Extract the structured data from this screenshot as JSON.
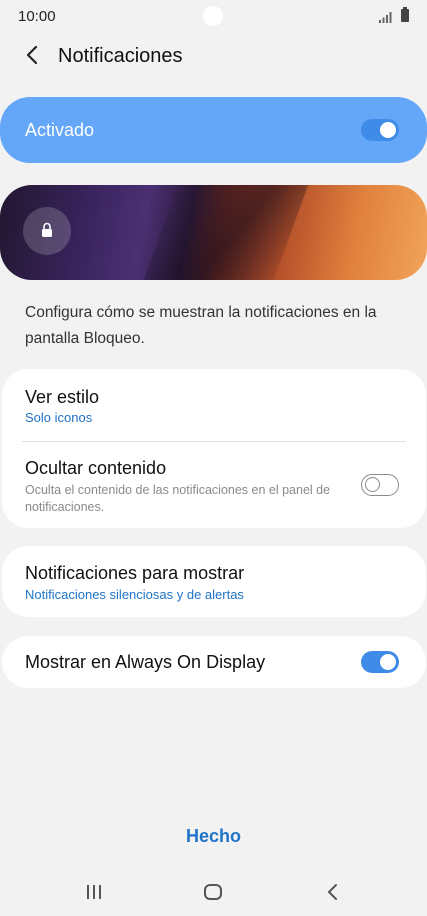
{
  "status_bar": {
    "time": "10:00"
  },
  "header": {
    "title": "Notificaciones"
  },
  "master_switch": {
    "label": "Activado",
    "state": "on"
  },
  "description": "Configura cómo se muestran la notificaciones en la pantalla Bloqueo.",
  "card1": {
    "ver_estilo": {
      "title": "Ver estilo",
      "value": "Solo iconos"
    },
    "ocultar": {
      "title": "Ocultar contenido",
      "subtitle": "Oculta el contenido de las notificaciones en el panel de notificaciones.",
      "state": "off"
    }
  },
  "card2": {
    "title": "Notificaciones para mostrar",
    "value": "Notificaciones silenciosas y de alertas"
  },
  "card3": {
    "title": "Mostrar en Always On Display",
    "state": "on"
  },
  "footer": {
    "done_label": "Hecho"
  },
  "colors": {
    "accent": "#1f74c8",
    "master_bg": "#64a6f7",
    "toggle_on": "#3f8be8"
  }
}
